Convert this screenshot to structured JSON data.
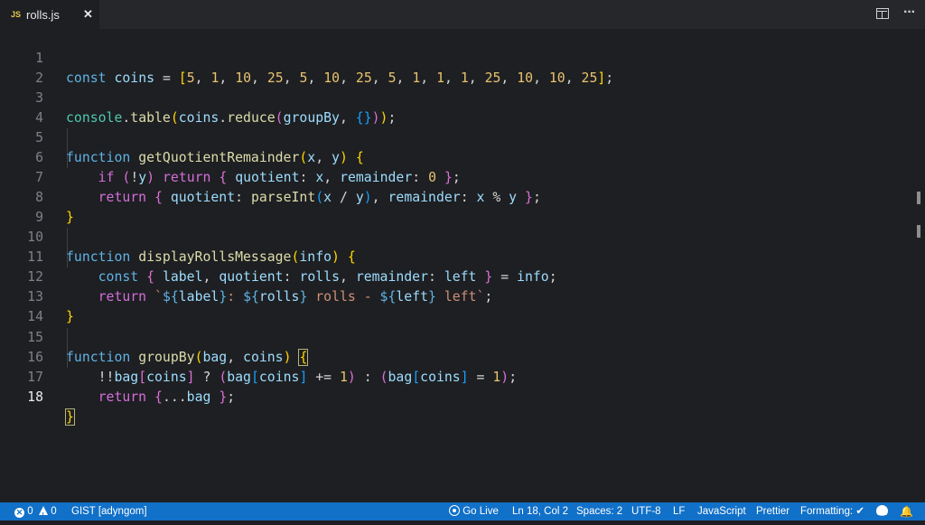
{
  "tab": {
    "badge": "JS",
    "filename": "rolls.js",
    "close": "✕"
  },
  "toolbar": {
    "more": "···"
  },
  "editor": {
    "lines": [
      {
        "n": "1"
      },
      {
        "n": "2"
      },
      {
        "n": "3"
      },
      {
        "n": "4"
      },
      {
        "n": "5"
      },
      {
        "n": "6"
      },
      {
        "n": "7"
      },
      {
        "n": "8"
      },
      {
        "n": "9"
      },
      {
        "n": "10"
      },
      {
        "n": "11"
      },
      {
        "n": "12"
      },
      {
        "n": "13"
      },
      {
        "n": "14"
      },
      {
        "n": "15"
      },
      {
        "n": "16"
      },
      {
        "n": "17"
      },
      {
        "n": "18"
      }
    ],
    "tokens": {
      "const": "const",
      "function": "function",
      "if": "if",
      "return": "return",
      "coins": "coins",
      "console": "console",
      "table": "table",
      "reduce": "reduce",
      "groupBy": "groupBy",
      "getQuotientRemainder": "getQuotientRemainder",
      "displayRollsMessage": "displayRollsMessage",
      "parseInt": "parseInt",
      "x": "x",
      "y": "y",
      "info": "info",
      "label": "label",
      "quotient": "quotient",
      "rolls": "rolls",
      "remainder": "remainder",
      "left": "left",
      "bag": "bag",
      "array_values": [
        "5",
        "1",
        "10",
        "25",
        "5",
        "10",
        "25",
        "5",
        "1",
        "1",
        "1",
        "25",
        "10",
        "10",
        "25"
      ],
      "zero": "0",
      "one": "1",
      "str_rolls": " rolls - ",
      "str_left": " left"
    }
  },
  "statusbar": {
    "errors": "0",
    "warnings": "0",
    "gist": "GIST [adyngom]",
    "golive": "Go Live",
    "position": "Ln 18, Col 2",
    "spaces": "Spaces: 2",
    "encoding": "UTF-8",
    "eol": "LF",
    "language": "JavaScript",
    "prettier": "Prettier",
    "formatting": "Formatting: ✔",
    "bell": "🔔"
  }
}
